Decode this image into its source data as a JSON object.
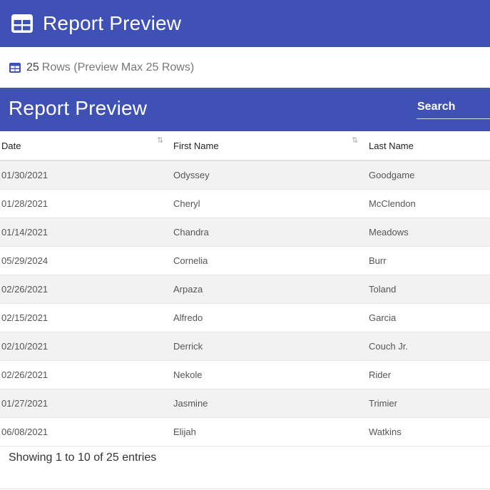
{
  "app": {
    "title": "Report Preview",
    "logo_icon": "table-grid-icon"
  },
  "summary": {
    "icon": "table-grid-icon",
    "count": "25",
    "rows_label": "Rows (Preview Max 25 Rows)"
  },
  "table_panel": {
    "title": "Report Preview",
    "search_placeholder": "Search"
  },
  "columns": [
    {
      "label": "Date",
      "sortable": true
    },
    {
      "label": "First Name",
      "sortable": true
    },
    {
      "label": "Last Name",
      "sortable": false
    }
  ],
  "rows": [
    {
      "date": "01/30/2021",
      "first": "Odyssey",
      "last": "Goodgame"
    },
    {
      "date": "01/28/2021",
      "first": "Cheryl",
      "last": "McClendon"
    },
    {
      "date": "01/14/2021",
      "first": "Chandra",
      "last": "Meadows"
    },
    {
      "date": "05/29/2024",
      "first": "Cornelia",
      "last": "Burr"
    },
    {
      "date": "02/26/2021",
      "first": "Arpaza",
      "last": "Toland"
    },
    {
      "date": "02/15/2021",
      "first": "Alfredo",
      "last": "Garcia"
    },
    {
      "date": "02/10/2021",
      "first": "Derrick",
      "last": "Couch Jr."
    },
    {
      "date": "02/26/2021",
      "first": "Nekole",
      "last": "Rider"
    },
    {
      "date": "01/27/2021",
      "first": "Jasmine",
      "last": "Trimier"
    },
    {
      "date": "06/08/2021",
      "first": "Elijah",
      "last": "Watkins"
    }
  ],
  "footer": {
    "info": "Showing 1 to 10 of 25 entries"
  },
  "colors": {
    "primary": "#3f51b5",
    "row_stripe": "#f2f2f2"
  }
}
